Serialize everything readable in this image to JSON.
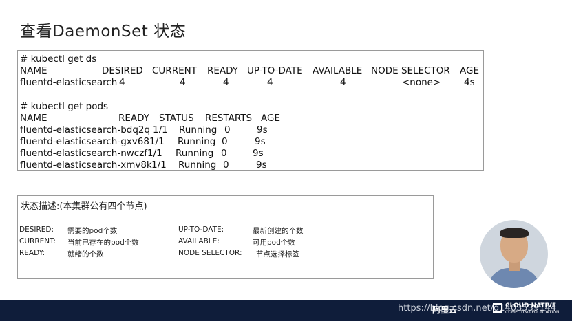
{
  "title": "查看DaemonSet 状态",
  "commands": {
    "get_ds_cmd": "# kubectl get ds",
    "ds_headers": [
      "NAME",
      "DESIRED",
      "CURRENT",
      "READY",
      "UP-TO-DATE",
      "AVAILABLE",
      "NODE SELECTOR",
      "AGE"
    ],
    "ds_rows": [
      [
        "fluentd-elasticsearch",
        "4",
        "4",
        "4",
        "4",
        "4",
        "<none>",
        "4s"
      ]
    ],
    "get_pods_cmd": "# kubectl get pods",
    "pod_headers": [
      "NAME",
      "READY",
      "STATUS",
      "RESTARTS",
      "AGE"
    ],
    "pod_rows": [
      [
        "fluentd-elasticsearch-bdq2q",
        "1/1",
        "Running",
        "0",
        "9s"
      ],
      [
        "fluentd-elasticsearch-gxv68",
        "1/1",
        "Running",
        "0",
        "9s"
      ],
      [
        "fluentd-elasticsearch-nwczf",
        "1/1",
        "Running",
        "0",
        "9s"
      ],
      [
        "fluentd-elasticsearch-xmv8k",
        "1/1",
        "Running",
        "0",
        "9s"
      ]
    ]
  },
  "description": {
    "title": "状态描述:(本集群公有四个节点)",
    "items": [
      {
        "term": "DESIRED:",
        "text": "需要的pod个数"
      },
      {
        "term": "CURRENT:",
        "text": "当前已存在的pod个数"
      },
      {
        "term": "READY:",
        "text": "就绪的个数"
      },
      {
        "term": "UP-TO-DATE:",
        "text": "最新创建的个数"
      },
      {
        "term": "AVAILABLE:",
        "text": "可用pod个数"
      },
      {
        "term": "NODE SELECTOR:",
        "text": "节点选择标签"
      }
    ]
  },
  "footer": {
    "url": "https://blog.csdn.net/q1403539144",
    "brand": "阿里云",
    "cloud_native": "CLOUD NATIVE",
    "cloud_native_sub": "COMPUTING FOUNDATION"
  }
}
